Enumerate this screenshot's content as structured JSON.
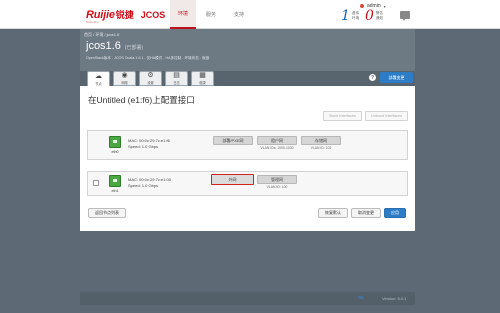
{
  "brand": {
    "name": "Ruijie",
    "name_cn": "锐捷",
    "product": "JCOS",
    "sub": "Networks"
  },
  "nav": [
    {
      "label": "环境",
      "active": true
    },
    {
      "label": "服务",
      "active": false
    },
    {
      "label": "支持",
      "active": false
    }
  ],
  "user": {
    "name": "admin"
  },
  "stats": [
    {
      "value": "1",
      "line1": "虚拟",
      "line2": "环境",
      "color": "#1a5fb4"
    },
    {
      "value": "0",
      "line1": "警告",
      "line2": "通知",
      "color": "#c0101a"
    }
  ],
  "icons": {
    "chat": "chat-icon",
    "help": "help-icon"
  },
  "header": {
    "breadcrumb": "首页 / 环境 / jcos1.6",
    "title": "jcos1.6",
    "title_tag": "(已部署)",
    "meta": "OpenStack版本 - JCOS Ocata 1.6.1 - 仅HA模式 - HA多控制 - 环境状态 - 就绪"
  },
  "tabs": [
    {
      "glyph": "☁",
      "label": "节点",
      "active": true,
      "icon": "cloud-icon"
    },
    {
      "glyph": "◉",
      "label": "网络",
      "active": false,
      "icon": "network-icon"
    },
    {
      "glyph": "⚙",
      "label": "设置",
      "active": false,
      "icon": "gear-icon"
    },
    {
      "glyph": "▤",
      "label": "日志",
      "active": false,
      "icon": "log-icon"
    },
    {
      "glyph": "▦",
      "label": "健康",
      "active": false,
      "icon": "health-icon"
    }
  ],
  "deploy_button": "部署变更",
  "panel": {
    "title": "在Untitled (e1:f6)上配置接口",
    "bond_buttons": [
      "Bond Interfaces",
      "Unbond Interfaces"
    ],
    "interfaces": [
      {
        "name": "eth0",
        "checkbox": false,
        "mac": "MAC: 00:0c:29:7c:e1:f6",
        "speed": "Speed: 1.0 Gbps",
        "networks": [
          {
            "label": "部署/PXE网",
            "vlan": "",
            "highlight": false
          },
          {
            "label": "租户网",
            "vlan": "VLAN IDs: 1000-1030",
            "highlight": false
          },
          {
            "label": "存储网",
            "vlan": "VLAN ID: 102",
            "highlight": false
          }
        ]
      },
      {
        "name": "eth1",
        "checkbox": true,
        "mac": "MAC: 00:0c:29:7c:e1:00",
        "speed": "Speed: 1.0 Gbps",
        "networks": [
          {
            "label": "外网",
            "vlan": "",
            "highlight": true
          },
          {
            "label": "管理网",
            "vlan": "VLAN ID: 100",
            "highlight": false
          }
        ]
      }
    ],
    "back_button": "返回节点列表",
    "footer_buttons": [
      {
        "label": "恢复默认",
        "primary": false
      },
      {
        "label": "取消变更",
        "primary": false
      },
      {
        "label": "应用",
        "primary": true
      }
    ]
  },
  "footer": {
    "status": "Ok",
    "version": "Version: 6.0.1"
  }
}
